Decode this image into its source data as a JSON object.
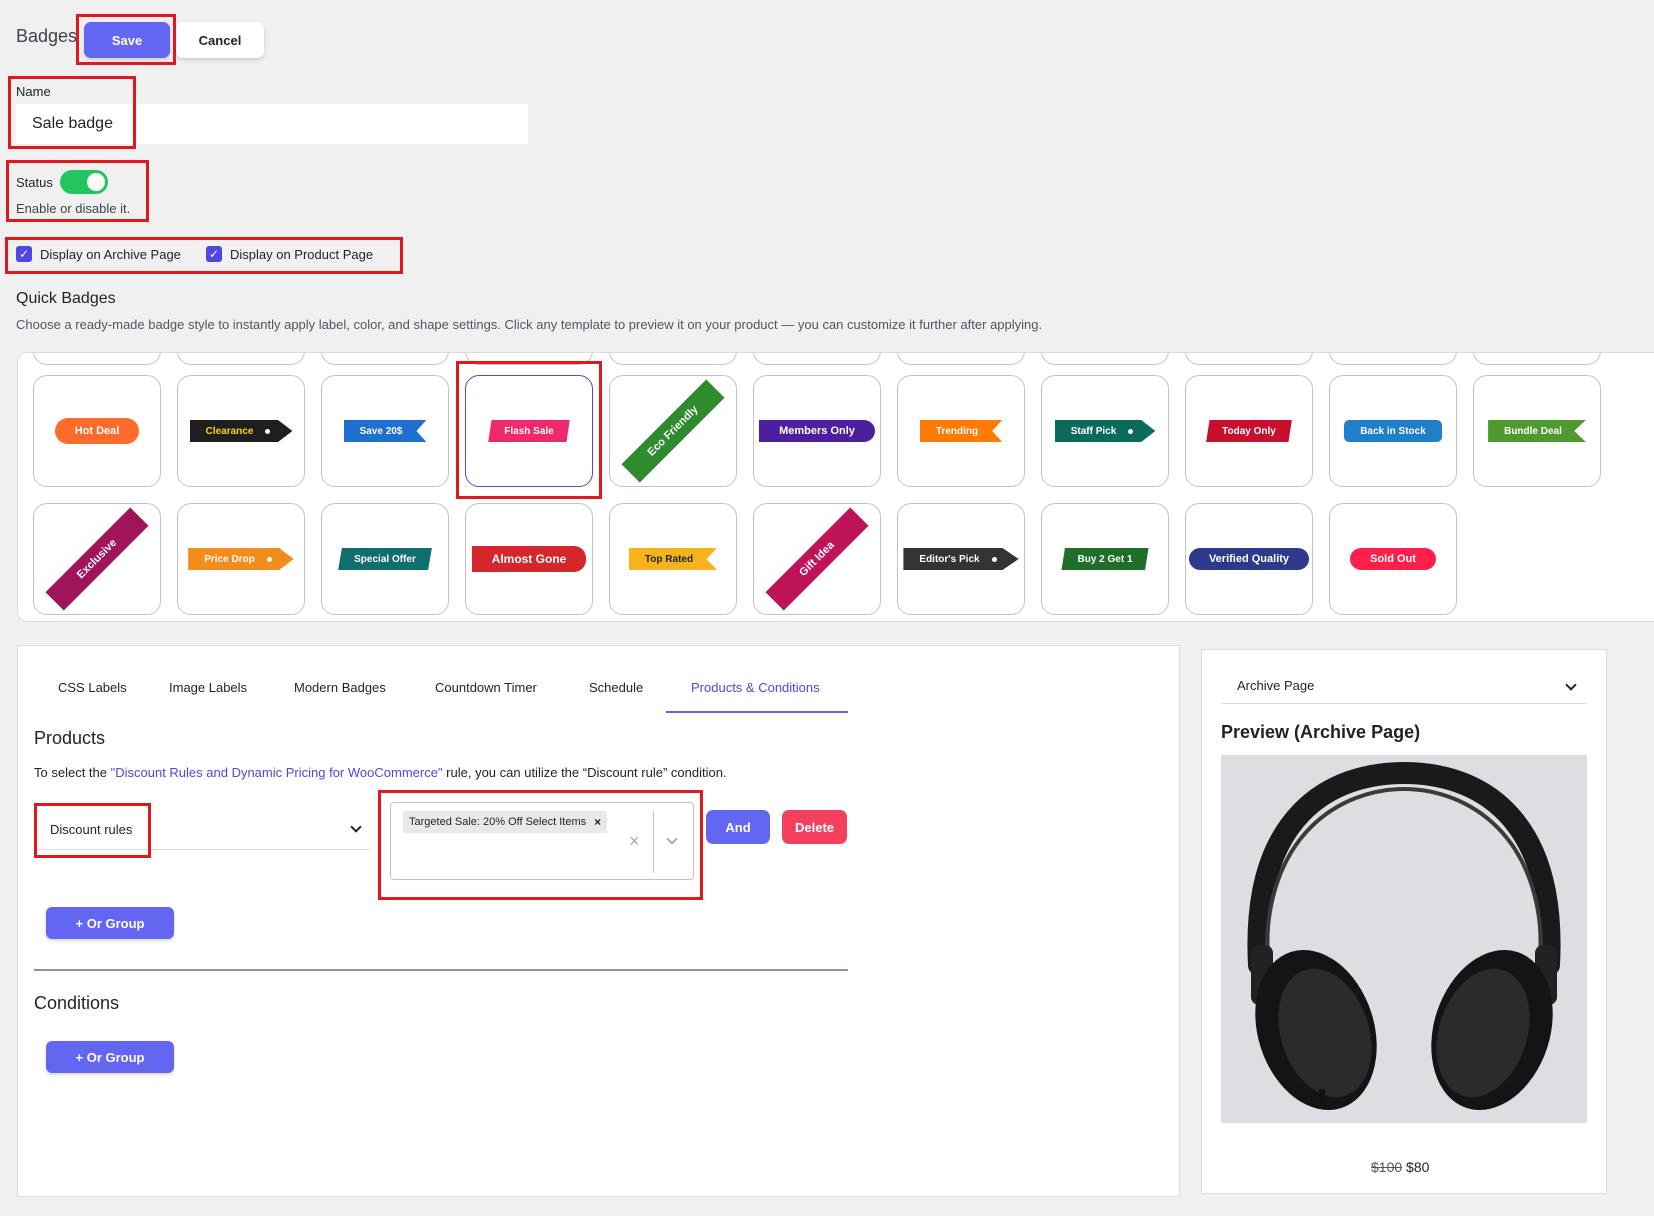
{
  "header": {
    "title": "Badges",
    "save_label": "Save",
    "cancel_label": "Cancel"
  },
  "name_field": {
    "label": "Name",
    "value": "Sale badge"
  },
  "status": {
    "label": "Status",
    "help": "Enable or disable it.",
    "enabled": true
  },
  "display_options": [
    {
      "label": "Display on Archive Page",
      "checked": true
    },
    {
      "label": "Display on Product Page",
      "checked": true
    }
  ],
  "quick_badges": {
    "title": "Quick Badges",
    "description": "Choose a ready-made badge style to instantly apply label, color, and shape settings. Click any template to preview it on your product — you can customize it further after applying.",
    "row1": [
      "Hot Deal",
      "Clearance",
      "Save 20$",
      "Flash Sale",
      "Eco Friendly",
      "Members Only",
      "Trending",
      "Staff Pick",
      "Today Only",
      "Back in Stock",
      "Bundle Deal"
    ],
    "row2": [
      "Exclusive",
      "Price Drop",
      "Special Offer",
      "Almost Gone",
      "Top Rated",
      "Gift Idea",
      "Editor's Pick",
      "Buy 2 Get 1",
      "Verified Quality",
      "Sold Out"
    ],
    "selected": "Flash Sale",
    "colors": {
      "hot_deal": "#ff6b2c",
      "clearance": "#1e1e1e",
      "save20": "#1f6fd1",
      "flash_sale": "#ee2a6b",
      "eco": "#2e8b2e",
      "members": "#4b1fa0",
      "trending": "#ff7a00",
      "staff": "#0b6b5a",
      "today": "#c8102e",
      "back_stock": "#1f7fc8",
      "bundle": "#4f9a2e",
      "exclusive": "#a0145a",
      "price_drop": "#f28c1b",
      "special": "#0f6e6e",
      "almost": "#d7262b",
      "top_rated": "#f7b21e",
      "gift": "#c0145a",
      "editors": "#333333",
      "buy2": "#1f6e2a",
      "verified": "#2d3a8c",
      "sold_out": "#ff1f4b"
    }
  },
  "tabs": [
    "CSS Labels",
    "Image Labels",
    "Modern Badges",
    "Countdown Timer",
    "Schedule",
    "Products & Conditions"
  ],
  "active_tab": "Products & Conditions",
  "products": {
    "title": "Products",
    "info_prefix": "To select the ",
    "info_link": "\"Discount Rules and Dynamic Pricing for WooCommerce\"",
    "info_suffix": " rule, you can utilize the “Discount rule” condition.",
    "rule_select": "Discount rules",
    "selected_item": "Targeted Sale: 20% Off Select Items",
    "and_label": "And",
    "delete_label": "Delete",
    "or_group_label": "+ Or Group"
  },
  "conditions": {
    "title": "Conditions",
    "or_group_label": "+ Or Group"
  },
  "preview": {
    "select_value": "Archive Page",
    "title": "Preview (Archive Page)",
    "old_price": "$100",
    "new_price": "$80"
  }
}
